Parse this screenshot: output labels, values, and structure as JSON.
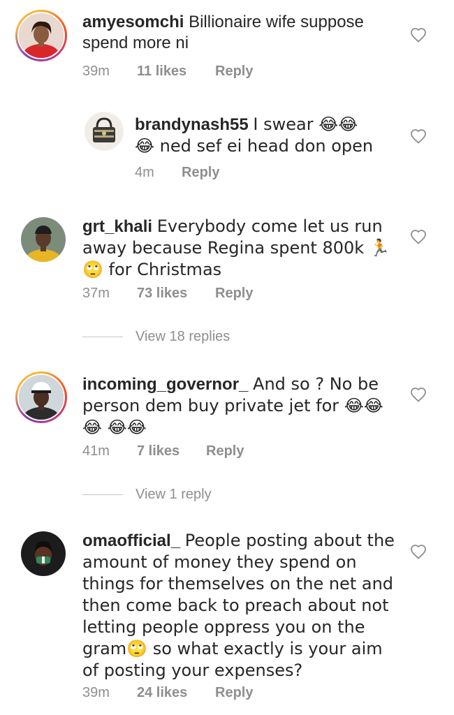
{
  "comments": [
    {
      "username": "amyesomchi",
      "text": "Billionaire wife suppose spend more ni",
      "time": "39m",
      "likes": "11 likes",
      "reply": "Reply",
      "avatar_icon": "profile-photo-woman-red"
    },
    {
      "username": "brandynash55",
      "text": "I swear 😂😂😂 ned sef ei head don open",
      "time": "4m",
      "reply": "Reply",
      "avatar_icon": "profile-photo-handbag"
    },
    {
      "username": "grt_khali",
      "text": "Everybody come let us run away because Regina spent 800k 🏃🙄 for Christmas",
      "time": "37m",
      "likes": "73 likes",
      "reply": "Reply",
      "view_replies": "View 18 replies",
      "avatar_icon": "profile-photo-man-yellow"
    },
    {
      "username": "incoming_governor_",
      "text": "And so ? No be person dem buy private jet for 😂😂😂 😂😂",
      "time": "41m",
      "likes": "7 likes",
      "reply": "Reply",
      "view_replies": "View 1 reply",
      "avatar_icon": "profile-photo-man-cap"
    },
    {
      "username": "omaofficial_",
      "text": "People posting about the amount of money they spend on things for themselves on the net and then come back to preach about not letting people oppress you on the gram🙄 so what exactly is your aim of posting your expenses?",
      "time": "39m",
      "likes": "24 likes",
      "reply": "Reply",
      "avatar_icon": "profile-photo-woman-mask"
    }
  ],
  "icons": {
    "like": "heart-outline-icon"
  },
  "colors": {
    "text": "#262626",
    "secondary": "#8e8e8e"
  }
}
